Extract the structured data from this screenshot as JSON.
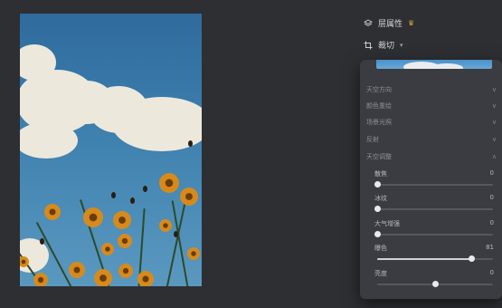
{
  "header": {
    "layer_props_label": "层属性",
    "crop_label": "裁切"
  },
  "panel": {
    "sections": [
      {
        "label": "天空方向"
      },
      {
        "label": "颜色重绘"
      },
      {
        "label": "场景光照"
      },
      {
        "label": "反射"
      },
      {
        "label": "天空调整"
      }
    ],
    "controls": [
      {
        "label": "散焦",
        "value": "0",
        "fraction": 0.0
      },
      {
        "label": "冰纹",
        "value": "0",
        "fraction": 0.0
      },
      {
        "label": "大气增强",
        "value": "0",
        "fraction": 0.0
      },
      {
        "label": "曝色",
        "value": "81",
        "fraction": 0.81
      },
      {
        "label": "亮度",
        "value": "0",
        "fraction": 0.5
      }
    ]
  },
  "icons": {
    "layer": "layers-icon",
    "crop": "crop-icon",
    "crown": "crown-icon",
    "chevron": "chevron-down-icon"
  },
  "colors": {
    "background": "#2d2f33",
    "panel": "#3a3c41",
    "accent_crown": "#d8a53a"
  }
}
